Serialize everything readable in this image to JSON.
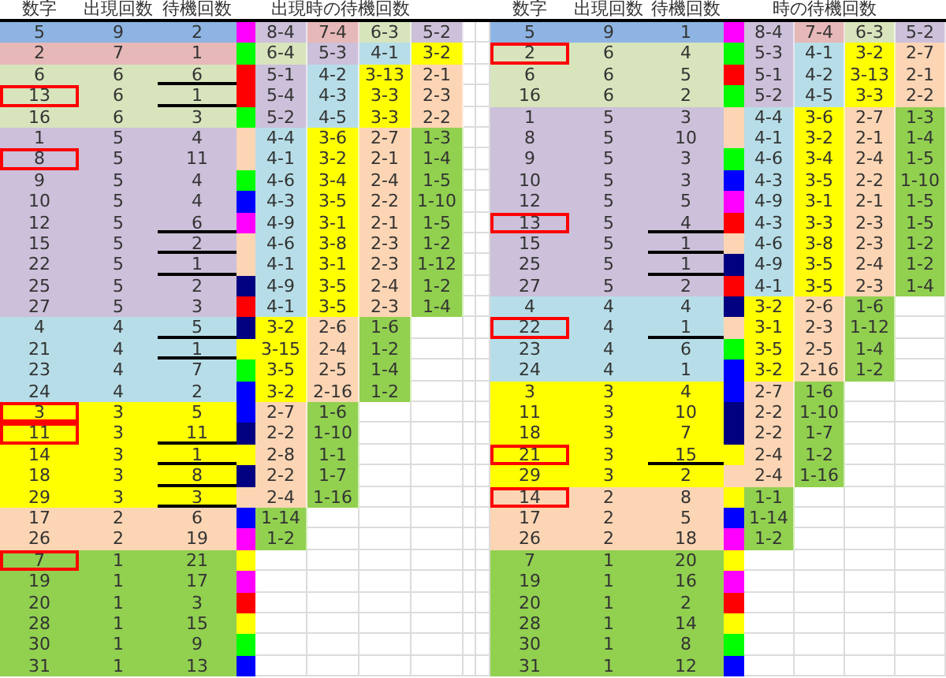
{
  "left": {
    "headers": [
      "数字",
      "出現回数",
      "待機回数"
    ],
    "group_header": "出現時の待機回数",
    "rows": [
      {
        "number": "5",
        "count": "9",
        "wait": "2",
        "color": "#8db4e2",
        "marker": {
          "color": "#ff00ff"
        },
        "boxed": false,
        "underlined": false,
        "intervals": [
          {
            "text": "8-4",
            "color": "#ccc0da"
          },
          {
            "text": "7-4",
            "color": "#e6b8b7"
          },
          {
            "text": "6-3",
            "color": "#d8e4bc"
          },
          {
            "text": "5-2",
            "color": "#ccc0da"
          }
        ]
      },
      {
        "number": "2",
        "count": "7",
        "wait": "1",
        "color": "#e6b8b7",
        "marker": {
          "color": "#00ff00"
        },
        "boxed": false,
        "underlined": false,
        "intervals": [
          {
            "text": "6-4",
            "color": "#d8e4bc"
          },
          {
            "text": "5-3",
            "color": "#ccc0da"
          },
          {
            "text": "4-1",
            "color": "#b7dee8"
          },
          {
            "text": "3-2",
            "color": "#ffff00"
          }
        ]
      },
      {
        "number": "6",
        "count": "6",
        "wait": "6",
        "color": "#d8e4bc",
        "marker": {
          "color": "#ff0000"
        },
        "boxed": false,
        "underlined": true,
        "intervals": [
          {
            "text": "5-1",
            "color": "#ccc0da"
          },
          {
            "text": "4-2",
            "color": "#b7dee8"
          },
          {
            "text": "3-13",
            "color": "#ffff00"
          },
          {
            "text": "2-1",
            "color": "#fcd5b4"
          }
        ]
      },
      {
        "number": "13",
        "count": "6",
        "wait": "1",
        "color": "#d8e4bc",
        "marker": {
          "color": "#ff0000"
        },
        "boxed": true,
        "underlined": true,
        "intervals": [
          {
            "text": "5-4",
            "color": "#ccc0da"
          },
          {
            "text": "4-3",
            "color": "#b7dee8"
          },
          {
            "text": "3-3",
            "color": "#ffff00"
          },
          {
            "text": "2-3",
            "color": "#fcd5b4"
          }
        ]
      },
      {
        "number": "16",
        "count": "6",
        "wait": "3",
        "color": "#d8e4bc",
        "marker": {
          "color": "#00ff00"
        },
        "boxed": false,
        "underlined": false,
        "intervals": [
          {
            "text": "5-2",
            "color": "#ccc0da"
          },
          {
            "text": "4-5",
            "color": "#b7dee8"
          },
          {
            "text": "3-3",
            "color": "#ffff00"
          },
          {
            "text": "2-2",
            "color": "#fcd5b4"
          }
        ]
      },
      {
        "number": "1",
        "count": "5",
        "wait": "4",
        "color": "#ccc0da",
        "marker": {
          "color": "#fcd5b4"
        },
        "boxed": false,
        "underlined": false,
        "intervals": [
          {
            "text": "4-4",
            "color": "#b7dee8"
          },
          {
            "text": "3-6",
            "color": "#ffff00"
          },
          {
            "text": "2-7",
            "color": "#fcd5b4"
          },
          {
            "text": "1-3",
            "color": "#92d050"
          }
        ]
      },
      {
        "number": "8",
        "count": "5",
        "wait": "11",
        "color": "#ccc0da",
        "marker": {
          "color": "#fcd5b4"
        },
        "boxed": true,
        "underlined": false,
        "intervals": [
          {
            "text": "4-1",
            "color": "#b7dee8"
          },
          {
            "text": "3-2",
            "color": "#ffff00"
          },
          {
            "text": "2-1",
            "color": "#fcd5b4"
          },
          {
            "text": "1-4",
            "color": "#92d050"
          }
        ]
      },
      {
        "number": "9",
        "count": "5",
        "wait": "4",
        "color": "#ccc0da",
        "marker": {
          "color": "#00ff00"
        },
        "boxed": false,
        "underlined": false,
        "intervals": [
          {
            "text": "4-6",
            "color": "#b7dee8"
          },
          {
            "text": "3-4",
            "color": "#ffff00"
          },
          {
            "text": "2-4",
            "color": "#fcd5b4"
          },
          {
            "text": "1-5",
            "color": "#92d050"
          }
        ]
      },
      {
        "number": "10",
        "count": "5",
        "wait": "4",
        "color": "#ccc0da",
        "marker": {
          "color": "#0000ff"
        },
        "boxed": false,
        "underlined": false,
        "intervals": [
          {
            "text": "4-3",
            "color": "#b7dee8"
          },
          {
            "text": "3-5",
            "color": "#ffff00"
          },
          {
            "text": "2-2",
            "color": "#fcd5b4"
          },
          {
            "text": "1-10",
            "color": "#92d050"
          }
        ]
      },
      {
        "number": "12",
        "count": "5",
        "wait": "6",
        "color": "#ccc0da",
        "marker": {
          "color": "#ff00ff"
        },
        "boxed": false,
        "underlined": true,
        "intervals": [
          {
            "text": "4-9",
            "color": "#b7dee8"
          },
          {
            "text": "3-1",
            "color": "#ffff00"
          },
          {
            "text": "2-1",
            "color": "#fcd5b4"
          },
          {
            "text": "1-5",
            "color": "#92d050"
          }
        ]
      },
      {
        "number": "15",
        "count": "5",
        "wait": "2",
        "color": "#ccc0da",
        "marker": {
          "color": "#fcd5b4"
        },
        "boxed": false,
        "underlined": true,
        "intervals": [
          {
            "text": "4-6",
            "color": "#b7dee8"
          },
          {
            "text": "3-8",
            "color": "#ffff00"
          },
          {
            "text": "2-3",
            "color": "#fcd5b4"
          },
          {
            "text": "1-2",
            "color": "#92d050"
          }
        ]
      },
      {
        "number": "22",
        "count": "5",
        "wait": "1",
        "color": "#ccc0da",
        "marker": {
          "color": "#fcd5b4"
        },
        "boxed": false,
        "underlined": true,
        "intervals": [
          {
            "text": "4-1",
            "color": "#b7dee8"
          },
          {
            "text": "3-1",
            "color": "#ffff00"
          },
          {
            "text": "2-3",
            "color": "#fcd5b4"
          },
          {
            "text": "1-12",
            "color": "#92d050"
          }
        ]
      },
      {
        "number": "25",
        "count": "5",
        "wait": "2",
        "color": "#ccc0da",
        "marker": {
          "color": "#000080"
        },
        "boxed": false,
        "underlined": false,
        "intervals": [
          {
            "text": "4-9",
            "color": "#b7dee8"
          },
          {
            "text": "3-5",
            "color": "#ffff00"
          },
          {
            "text": "2-4",
            "color": "#fcd5b4"
          },
          {
            "text": "1-2",
            "color": "#92d050"
          }
        ]
      },
      {
        "number": "27",
        "count": "5",
        "wait": "3",
        "color": "#ccc0da",
        "marker": {
          "color": "#ff0000"
        },
        "boxed": false,
        "underlined": false,
        "intervals": [
          {
            "text": "4-1",
            "color": "#b7dee8"
          },
          {
            "text": "3-5",
            "color": "#ffff00"
          },
          {
            "text": "2-3",
            "color": "#fcd5b4"
          },
          {
            "text": "1-4",
            "color": "#92d050"
          }
        ]
      },
      {
        "number": "4",
        "count": "4",
        "wait": "5",
        "color": "#b7dee8",
        "marker": {
          "color": "#000080"
        },
        "boxed": false,
        "underlined": true,
        "intervals": [
          {
            "text": "3-2",
            "color": "#ffff00"
          },
          {
            "text": "2-6",
            "color": "#fcd5b4"
          },
          {
            "text": "1-6",
            "color": "#92d050"
          }
        ]
      },
      {
        "number": "21",
        "count": "4",
        "wait": "1",
        "color": "#b7dee8",
        "marker": {
          "color": "#ffff00"
        },
        "boxed": false,
        "underlined": true,
        "intervals": [
          {
            "text": "3-15",
            "color": "#ffff00"
          },
          {
            "text": "2-4",
            "color": "#fcd5b4"
          },
          {
            "text": "1-2",
            "color": "#92d050"
          }
        ]
      },
      {
        "number": "23",
        "count": "4",
        "wait": "7",
        "color": "#b7dee8",
        "marker": {
          "color": "#00ff00"
        },
        "boxed": false,
        "underlined": false,
        "intervals": [
          {
            "text": "3-5",
            "color": "#ffff00"
          },
          {
            "text": "2-5",
            "color": "#fcd5b4"
          },
          {
            "text": "1-4",
            "color": "#92d050"
          }
        ]
      },
      {
        "number": "24",
        "count": "4",
        "wait": "2",
        "color": "#b7dee8",
        "marker": {
          "color": "#0000ff"
        },
        "boxed": false,
        "underlined": false,
        "intervals": [
          {
            "text": "3-2",
            "color": "#ffff00"
          },
          {
            "text": "2-16",
            "color": "#fcd5b4"
          },
          {
            "text": "1-2",
            "color": "#92d050"
          }
        ]
      },
      {
        "number": "3",
        "count": "3",
        "wait": "5",
        "color": "#ffff00",
        "marker": {
          "color": "#0000ff"
        },
        "boxed": true,
        "underlined": false,
        "intervals": [
          {
            "text": "2-7",
            "color": "#fcd5b4"
          },
          {
            "text": "1-6",
            "color": "#92d050"
          }
        ]
      },
      {
        "number": "11",
        "count": "3",
        "wait": "11",
        "color": "#ffff00",
        "marker": {
          "color": "#000080"
        },
        "boxed": true,
        "underlined": true,
        "intervals": [
          {
            "text": "2-2",
            "color": "#fcd5b4"
          },
          {
            "text": "1-10",
            "color": "#92d050"
          }
        ]
      },
      {
        "number": "14",
        "count": "3",
        "wait": "1",
        "color": "#ffff00",
        "marker": {
          "color": "#ffff00"
        },
        "boxed": false,
        "underlined": true,
        "intervals": [
          {
            "text": "2-8",
            "color": "#fcd5b4"
          },
          {
            "text": "1-1",
            "color": "#92d050"
          }
        ]
      },
      {
        "number": "18",
        "count": "3",
        "wait": "8",
        "color": "#ffff00",
        "marker": {
          "color": "#000080"
        },
        "boxed": false,
        "underlined": true,
        "intervals": [
          {
            "text": "2-2",
            "color": "#fcd5b4"
          },
          {
            "text": "1-7",
            "color": "#92d050"
          }
        ]
      },
      {
        "number": "29",
        "count": "3",
        "wait": "3",
        "color": "#ffff00",
        "marker": {
          "color": "#fcd5b4"
        },
        "boxed": false,
        "underlined": true,
        "intervals": [
          {
            "text": "2-4",
            "color": "#fcd5b4"
          },
          {
            "text": "1-16",
            "color": "#92d050"
          }
        ]
      },
      {
        "number": "17",
        "count": "2",
        "wait": "6",
        "color": "#fcd5b4",
        "marker": {
          "color": "#0000ff"
        },
        "boxed": false,
        "underlined": false,
        "intervals": [
          {
            "text": "1-14",
            "color": "#92d050"
          }
        ]
      },
      {
        "number": "26",
        "count": "2",
        "wait": "19",
        "color": "#fcd5b4",
        "marker": {
          "color": "#ff00ff"
        },
        "boxed": false,
        "underlined": false,
        "intervals": [
          {
            "text": "1-2",
            "color": "#92d050"
          }
        ]
      },
      {
        "number": "7",
        "count": "1",
        "wait": "21",
        "color": "#92d050",
        "marker": {
          "color": "#ffff00"
        },
        "boxed": true,
        "underlined": false,
        "intervals": []
      },
      {
        "number": "19",
        "count": "1",
        "wait": "17",
        "color": "#92d050",
        "marker": {
          "color": "#ff00ff"
        },
        "boxed": false,
        "underlined": false,
        "intervals": []
      },
      {
        "number": "20",
        "count": "1",
        "wait": "3",
        "color": "#92d050",
        "marker": {
          "color": "#ff0000"
        },
        "boxed": false,
        "underlined": false,
        "intervals": []
      },
      {
        "number": "28",
        "count": "1",
        "wait": "15",
        "color": "#92d050",
        "marker": {
          "color": "#ffff00"
        },
        "boxed": false,
        "underlined": false,
        "intervals": []
      },
      {
        "number": "30",
        "count": "1",
        "wait": "9",
        "color": "#92d050",
        "marker": {
          "color": "#00ff00"
        },
        "boxed": false,
        "underlined": false,
        "intervals": []
      },
      {
        "number": "31",
        "count": "1",
        "wait": "13",
        "color": "#92d050",
        "marker": {
          "color": "#0000ff"
        },
        "boxed": false,
        "underlined": false,
        "intervals": []
      }
    ]
  },
  "right": {
    "headers": [
      "数字",
      "出現回数",
      "待機回数"
    ],
    "group_header": "時の待機回数",
    "rows": [
      {
        "number": "5",
        "count": "9",
        "wait": "1",
        "color": "#8db4e2",
        "marker": {
          "color": "#ff00ff"
        },
        "boxed": false,
        "underlined": false,
        "intervals": [
          {
            "text": "8-4",
            "color": "#ccc0da"
          },
          {
            "text": "7-4",
            "color": "#e6b8b7"
          },
          {
            "text": "6-3",
            "color": "#d8e4bc"
          },
          {
            "text": "5-2",
            "color": "#ccc0da"
          }
        ]
      },
      {
        "number": "2",
        "count": "6",
        "wait": "4",
        "color": "#d8e4bc",
        "marker": {
          "color": "#00ff00"
        },
        "boxed": true,
        "underlined": false,
        "intervals": [
          {
            "text": "5-3",
            "color": "#ccc0da"
          },
          {
            "text": "4-1",
            "color": "#b7dee8"
          },
          {
            "text": "3-2",
            "color": "#ffff00"
          },
          {
            "text": "2-7",
            "color": "#fcd5b4"
          }
        ]
      },
      {
        "number": "6",
        "count": "6",
        "wait": "5",
        "color": "#d8e4bc",
        "marker": {
          "color": "#ff0000"
        },
        "boxed": false,
        "underlined": false,
        "intervals": [
          {
            "text": "5-1",
            "color": "#ccc0da"
          },
          {
            "text": "4-2",
            "color": "#b7dee8"
          },
          {
            "text": "3-13",
            "color": "#ffff00"
          },
          {
            "text": "2-1",
            "color": "#fcd5b4"
          }
        ]
      },
      {
        "number": "16",
        "count": "6",
        "wait": "2",
        "color": "#d8e4bc",
        "marker": {
          "color": "#00ff00"
        },
        "boxed": false,
        "underlined": false,
        "intervals": [
          {
            "text": "5-2",
            "color": "#ccc0da"
          },
          {
            "text": "4-5",
            "color": "#b7dee8"
          },
          {
            "text": "3-3",
            "color": "#ffff00"
          },
          {
            "text": "2-2",
            "color": "#fcd5b4"
          }
        ]
      },
      {
        "number": "1",
        "count": "5",
        "wait": "3",
        "color": "#ccc0da",
        "marker": {
          "color": "#fcd5b4"
        },
        "boxed": false,
        "underlined": false,
        "intervals": [
          {
            "text": "4-4",
            "color": "#b7dee8"
          },
          {
            "text": "3-6",
            "color": "#ffff00"
          },
          {
            "text": "2-7",
            "color": "#fcd5b4"
          },
          {
            "text": "1-3",
            "color": "#92d050"
          }
        ]
      },
      {
        "number": "8",
        "count": "5",
        "wait": "10",
        "color": "#ccc0da",
        "marker": {
          "color": "#fcd5b4"
        },
        "boxed": false,
        "underlined": false,
        "intervals": [
          {
            "text": "4-1",
            "color": "#b7dee8"
          },
          {
            "text": "3-2",
            "color": "#ffff00"
          },
          {
            "text": "2-1",
            "color": "#fcd5b4"
          },
          {
            "text": "1-4",
            "color": "#92d050"
          }
        ]
      },
      {
        "number": "9",
        "count": "5",
        "wait": "3",
        "color": "#ccc0da",
        "marker": {
          "color": "#00ff00"
        },
        "boxed": false,
        "underlined": false,
        "intervals": [
          {
            "text": "4-6",
            "color": "#b7dee8"
          },
          {
            "text": "3-4",
            "color": "#ffff00"
          },
          {
            "text": "2-4",
            "color": "#fcd5b4"
          },
          {
            "text": "1-5",
            "color": "#92d050"
          }
        ]
      },
      {
        "number": "10",
        "count": "5",
        "wait": "3",
        "color": "#ccc0da",
        "marker": {
          "color": "#0000ff"
        },
        "boxed": false,
        "underlined": false,
        "intervals": [
          {
            "text": "4-3",
            "color": "#b7dee8"
          },
          {
            "text": "3-5",
            "color": "#ffff00"
          },
          {
            "text": "2-2",
            "color": "#fcd5b4"
          },
          {
            "text": "1-10",
            "color": "#92d050"
          }
        ]
      },
      {
        "number": "12",
        "count": "5",
        "wait": "5",
        "color": "#ccc0da",
        "marker": {
          "color": "#ff00ff"
        },
        "boxed": false,
        "underlined": false,
        "intervals": [
          {
            "text": "4-9",
            "color": "#b7dee8"
          },
          {
            "text": "3-1",
            "color": "#ffff00"
          },
          {
            "text": "2-1",
            "color": "#fcd5b4"
          },
          {
            "text": "1-5",
            "color": "#92d050"
          }
        ]
      },
      {
        "number": "13",
        "count": "5",
        "wait": "4",
        "color": "#ccc0da",
        "marker": {
          "color": "#ff0000"
        },
        "boxed": true,
        "underlined": true,
        "intervals": [
          {
            "text": "4-3",
            "color": "#b7dee8"
          },
          {
            "text": "3-3",
            "color": "#ffff00"
          },
          {
            "text": "2-3",
            "color": "#fcd5b4"
          },
          {
            "text": "1-5",
            "color": "#92d050"
          }
        ]
      },
      {
        "number": "15",
        "count": "5",
        "wait": "1",
        "color": "#ccc0da",
        "marker": {
          "color": "#fcd5b4"
        },
        "boxed": false,
        "underlined": true,
        "intervals": [
          {
            "text": "4-6",
            "color": "#b7dee8"
          },
          {
            "text": "3-8",
            "color": "#ffff00"
          },
          {
            "text": "2-3",
            "color": "#fcd5b4"
          },
          {
            "text": "1-2",
            "color": "#92d050"
          }
        ]
      },
      {
        "number": "25",
        "count": "5",
        "wait": "1",
        "color": "#ccc0da",
        "marker": {
          "color": "#000080"
        },
        "boxed": false,
        "underlined": true,
        "intervals": [
          {
            "text": "4-9",
            "color": "#b7dee8"
          },
          {
            "text": "3-5",
            "color": "#ffff00"
          },
          {
            "text": "2-4",
            "color": "#fcd5b4"
          },
          {
            "text": "1-2",
            "color": "#92d050"
          }
        ]
      },
      {
        "number": "27",
        "count": "5",
        "wait": "2",
        "color": "#ccc0da",
        "marker": {
          "color": "#ff0000"
        },
        "boxed": false,
        "underlined": false,
        "intervals": [
          {
            "text": "4-1",
            "color": "#b7dee8"
          },
          {
            "text": "3-5",
            "color": "#ffff00"
          },
          {
            "text": "2-3",
            "color": "#fcd5b4"
          },
          {
            "text": "1-4",
            "color": "#92d050"
          }
        ]
      },
      {
        "number": "4",
        "count": "4",
        "wait": "4",
        "color": "#b7dee8",
        "marker": {
          "color": "#000080"
        },
        "boxed": false,
        "underlined": false,
        "intervals": [
          {
            "text": "3-2",
            "color": "#ffff00"
          },
          {
            "text": "2-6",
            "color": "#fcd5b4"
          },
          {
            "text": "1-6",
            "color": "#92d050"
          }
        ]
      },
      {
        "number": "22",
        "count": "4",
        "wait": "1",
        "color": "#b7dee8",
        "marker": {
          "color": "#fcd5b4"
        },
        "boxed": true,
        "underlined": true,
        "intervals": [
          {
            "text": "3-1",
            "color": "#ffff00"
          },
          {
            "text": "2-3",
            "color": "#fcd5b4"
          },
          {
            "text": "1-12",
            "color": "#92d050"
          }
        ]
      },
      {
        "number": "23",
        "count": "4",
        "wait": "6",
        "color": "#b7dee8",
        "marker": {
          "color": "#00ff00"
        },
        "boxed": false,
        "underlined": false,
        "intervals": [
          {
            "text": "3-5",
            "color": "#ffff00"
          },
          {
            "text": "2-5",
            "color": "#fcd5b4"
          },
          {
            "text": "1-4",
            "color": "#92d050"
          }
        ]
      },
      {
        "number": "24",
        "count": "4",
        "wait": "1",
        "color": "#b7dee8",
        "marker": {
          "color": "#0000ff"
        },
        "boxed": false,
        "underlined": false,
        "intervals": [
          {
            "text": "3-2",
            "color": "#ffff00"
          },
          {
            "text": "2-16",
            "color": "#fcd5b4"
          },
          {
            "text": "1-2",
            "color": "#92d050"
          }
        ]
      },
      {
        "number": "3",
        "count": "3",
        "wait": "4",
        "color": "#ffff00",
        "marker": {
          "color": "#0000ff"
        },
        "boxed": false,
        "underlined": false,
        "intervals": [
          {
            "text": "2-7",
            "color": "#fcd5b4"
          },
          {
            "text": "1-6",
            "color": "#92d050"
          }
        ]
      },
      {
        "number": "11",
        "count": "3",
        "wait": "10",
        "color": "#ffff00",
        "marker": {
          "color": "#000080"
        },
        "boxed": false,
        "underlined": false,
        "intervals": [
          {
            "text": "2-2",
            "color": "#fcd5b4"
          },
          {
            "text": "1-10",
            "color": "#92d050"
          }
        ]
      },
      {
        "number": "18",
        "count": "3",
        "wait": "7",
        "color": "#ffff00",
        "marker": {
          "color": "#000080"
        },
        "boxed": false,
        "underlined": false,
        "intervals": [
          {
            "text": "2-2",
            "color": "#fcd5b4"
          },
          {
            "text": "1-7",
            "color": "#92d050"
          }
        ]
      },
      {
        "number": "21",
        "count": "3",
        "wait": "15",
        "color": "#ffff00",
        "marker": {
          "color": "#ffff00"
        },
        "boxed": true,
        "underlined": true,
        "intervals": [
          {
            "text": "2-4",
            "color": "#fcd5b4"
          },
          {
            "text": "1-2",
            "color": "#92d050"
          }
        ]
      },
      {
        "number": "29",
        "count": "3",
        "wait": "2",
        "color": "#ffff00",
        "marker": {
          "color": "#fcd5b4"
        },
        "boxed": false,
        "underlined": false,
        "intervals": [
          {
            "text": "2-4",
            "color": "#fcd5b4"
          },
          {
            "text": "1-16",
            "color": "#92d050"
          }
        ]
      },
      {
        "number": "14",
        "count": "2",
        "wait": "8",
        "color": "#fcd5b4",
        "marker": {
          "color": "#ffff00"
        },
        "boxed": true,
        "underlined": false,
        "intervals": [
          {
            "text": "1-1",
            "color": "#92d050"
          }
        ]
      },
      {
        "number": "17",
        "count": "2",
        "wait": "5",
        "color": "#fcd5b4",
        "marker": {
          "color": "#0000ff"
        },
        "boxed": false,
        "underlined": false,
        "intervals": [
          {
            "text": "1-14",
            "color": "#92d050"
          }
        ]
      },
      {
        "number": "26",
        "count": "2",
        "wait": "18",
        "color": "#fcd5b4",
        "marker": {
          "color": "#ff00ff"
        },
        "boxed": false,
        "underlined": false,
        "intervals": [
          {
            "text": "1-2",
            "color": "#92d050"
          }
        ]
      },
      {
        "number": "7",
        "count": "1",
        "wait": "20",
        "color": "#92d050",
        "marker": {
          "color": "#ffff00"
        },
        "boxed": false,
        "underlined": false,
        "intervals": []
      },
      {
        "number": "19",
        "count": "1",
        "wait": "16",
        "color": "#92d050",
        "marker": {
          "color": "#ff00ff"
        },
        "boxed": false,
        "underlined": false,
        "intervals": []
      },
      {
        "number": "20",
        "count": "1",
        "wait": "2",
        "color": "#92d050",
        "marker": {
          "color": "#ff0000"
        },
        "boxed": false,
        "underlined": false,
        "intervals": []
      },
      {
        "number": "28",
        "count": "1",
        "wait": "14",
        "color": "#92d050",
        "marker": {
          "color": "#ffff00"
        },
        "boxed": false,
        "underlined": false,
        "intervals": []
      },
      {
        "number": "30",
        "count": "1",
        "wait": "8",
        "color": "#92d050",
        "marker": {
          "color": "#00ff00"
        },
        "boxed": false,
        "underlined": false,
        "intervals": []
      },
      {
        "number": "31",
        "count": "1",
        "wait": "12",
        "color": "#92d050",
        "marker": {
          "color": "#0000ff"
        },
        "boxed": false,
        "underlined": false,
        "intervals": []
      }
    ]
  }
}
